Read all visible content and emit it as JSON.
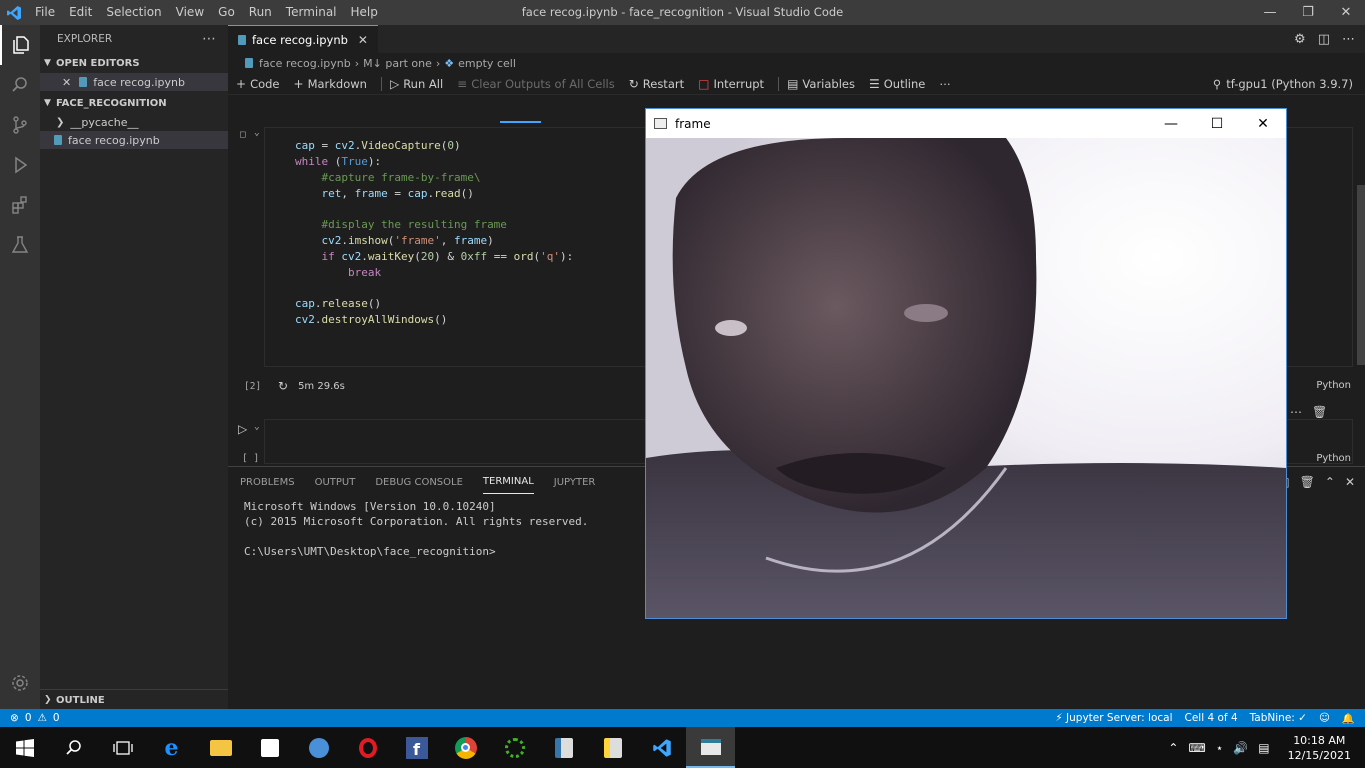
{
  "titlebar": {
    "menu": [
      "File",
      "Edit",
      "Selection",
      "View",
      "Go",
      "Run",
      "Terminal",
      "Help"
    ],
    "window_title": "face recog.ipynb - face_recognition - Visual Studio Code"
  },
  "sidebar": {
    "title": "EXPLORER",
    "open_editors": "OPEN EDITORS",
    "open_file": "face recog.ipynb",
    "folder": "FACE_RECOGNITION",
    "items": [
      "__pycache__",
      "face recog.ipynb"
    ],
    "outline": "OUTLINE"
  },
  "tab": {
    "label": "face recog.ipynb"
  },
  "breadcrumb": {
    "file": "face recog.ipynb",
    "md": "M↓ part one",
    "cell": "empty cell"
  },
  "notebook_toolbar": {
    "code": "Code",
    "markdown": "Markdown",
    "run_all": "Run All",
    "clear_outputs": "Clear Outputs of All Cells",
    "restart": "Restart",
    "interrupt": "Interrupt",
    "variables": "Variables",
    "outline": "Outline",
    "kernel": "tf-gpu1 (Python 3.9.7)"
  },
  "cell": {
    "exec_count": "[2]",
    "exec_time": "5m 29.6s",
    "language": "Python",
    "empty_count": "[ ]",
    "empty_language": "Python"
  },
  "panel": {
    "tabs": [
      "PROBLEMS",
      "OUTPUT",
      "DEBUG CONSOLE",
      "TERMINAL",
      "JUPYTER"
    ],
    "terminal_lines": [
      "Microsoft Windows [Version 10.0.10240]",
      "(c) 2015 Microsoft Corporation. All rights reserved.",
      "",
      "C:\\Users\\UMT\\Desktop\\face_recognition>"
    ]
  },
  "statusbar": {
    "errors": "0",
    "warnings": "0",
    "jupyter": "Jupyter Server: local",
    "cell_pos": "Cell 4 of 4",
    "tabnine": "TabNine: ✓"
  },
  "frame_window": {
    "title": "frame"
  },
  "taskbar": {
    "time": "10:18 AM",
    "date": "12/15/2021"
  },
  "colors": {
    "accent": "#007acc",
    "titlebar": "#3c3c3c",
    "sidebar": "#252526"
  }
}
